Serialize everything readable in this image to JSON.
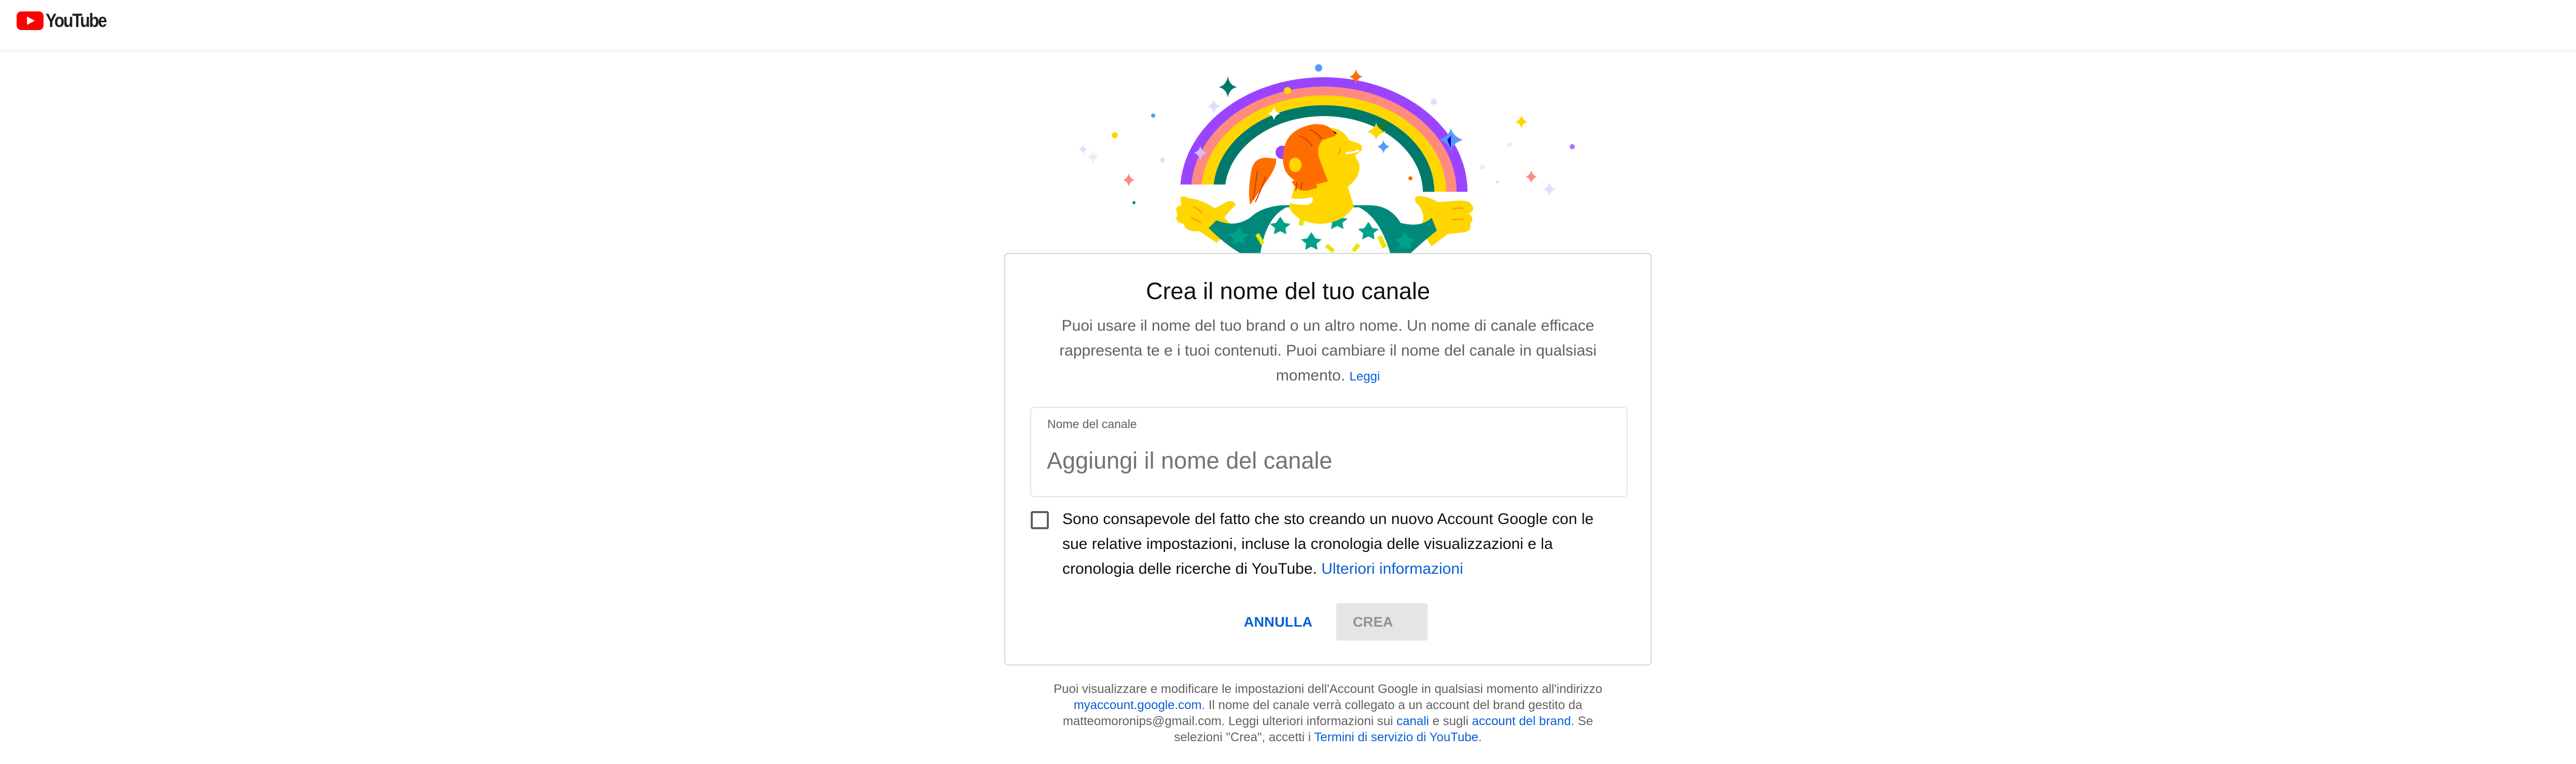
{
  "header": {
    "logo_text": "YouTube"
  },
  "illustration": {
    "alt": "rainbow-celebration-illustration",
    "colors": {
      "purple": "#9b44ff",
      "pink": "#ff8a80",
      "yellow": "#ffd600",
      "teal": "#00796b",
      "orange_hair": "#ff6d00",
      "skin": "#ffd600",
      "shirt": "#00897b",
      "shirt_pattern": "#00a18a",
      "confetti": "#e6e600"
    }
  },
  "card": {
    "title": "Crea il nome del tuo canale",
    "description": "Puoi usare il nome del tuo brand o un altro nome. Un nome di canale efficace rappresenta te e i tuoi contenuti. Puoi cambiare il nome del canale in qualsiasi momento.",
    "description_link": "Leggi",
    "input": {
      "label": "Nome del canale",
      "value": "",
      "placeholder": "Aggiungi il nome del canale"
    },
    "consent": {
      "checked": false,
      "text": "Sono consapevole del fatto che sto creando un nuovo Account Google con le sue relative impostazioni, incluse la cronologia delle visualizzazioni e la cronologia delle ricerche di YouTube.",
      "link": "Ulteriori informazioni"
    },
    "buttons": {
      "cancel": "ANNULLA",
      "create": "CREA"
    }
  },
  "footer": {
    "part1": "Puoi visualizzare e modificare le impostazioni dell'Account Google in qualsiasi momento all'indirizzo",
    "link_account": "myaccount.google.com",
    "part2": ". Il nome del canale verrà collegato a un account del brand gestito da matteomoronips@gmail.com. Leggi ulteriori informazioni sui",
    "link_channels": "canali",
    "part3": "e sugli",
    "link_brand_accounts": "account del brand",
    "part4": ". Se selezioni \"Crea\", accetti i",
    "link_terms": "Termini di servizio di YouTube",
    "part5": "."
  },
  "colors": {
    "link_blue": "#065fd4",
    "brand_red": "#ff0000",
    "disabled_button_bg": "#e5e5e5",
    "disabled_button_text": "#909090"
  }
}
